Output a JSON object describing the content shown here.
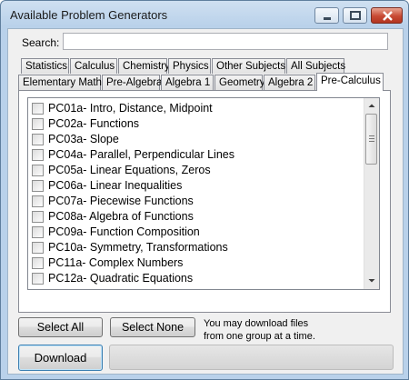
{
  "window": {
    "title": "Available Problem Generators"
  },
  "search": {
    "label": "Search:",
    "value": "",
    "placeholder": ""
  },
  "tabs_row1": [
    {
      "label": "Statistics"
    },
    {
      "label": "Calculus"
    },
    {
      "label": "Chemistry"
    },
    {
      "label": "Physics"
    },
    {
      "label": "Other Subjects"
    },
    {
      "label": "All Subjects"
    }
  ],
  "tabs_row2": [
    {
      "label": "Elementary Math"
    },
    {
      "label": "Pre-Algebra"
    },
    {
      "label": "Algebra 1"
    },
    {
      "label": "Geometry"
    },
    {
      "label": "Algebra 2"
    },
    {
      "label": "Pre-Calculus",
      "selected": true
    }
  ],
  "items": [
    {
      "label": "PC01a- Intro, Distance, Midpoint",
      "checked": false
    },
    {
      "label": "PC02a- Functions",
      "checked": false
    },
    {
      "label": "PC03a- Slope",
      "checked": false
    },
    {
      "label": "PC04a- Parallel, Perpendicular Lines",
      "checked": false
    },
    {
      "label": "PC05a- Linear Equations, Zeros",
      "checked": false
    },
    {
      "label": "PC06a- Linear Inequalities",
      "checked": false
    },
    {
      "label": "PC07a- Piecewise Functions",
      "checked": false
    },
    {
      "label": "PC08a- Algebra of Functions",
      "checked": false
    },
    {
      "label": "PC09a- Function Composition",
      "checked": false
    },
    {
      "label": "PC10a- Symmetry, Transformations",
      "checked": false
    },
    {
      "label": "PC11a- Complex Numbers",
      "checked": false
    },
    {
      "label": "PC12a- Quadratic Equations",
      "checked": false
    }
  ],
  "buttons": {
    "select_all": "Select All",
    "select_none": "Select None",
    "download": "Download"
  },
  "note": {
    "line1": "You may download files",
    "line2": "from one group at a time."
  },
  "progress": {
    "value": 0
  }
}
